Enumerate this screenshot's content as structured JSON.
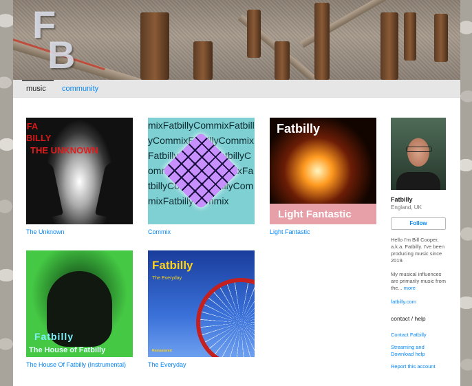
{
  "logo": {
    "letter1": "F",
    "letter2": "B"
  },
  "tabs": [
    {
      "label": "music"
    },
    {
      "label": "community"
    }
  ],
  "albums": [
    {
      "title": "The Unknown",
      "cover_text": {
        "vertical": "FA BILLY",
        "main": "THE UNKNOWN"
      }
    },
    {
      "title": "Commix",
      "cover_text": {
        "pattern": "mixFatbillyCommixFatbillyCommixFatbillyCommixFatbillyCommixFatbillyCommixFatbillyCommixFatbillyCommixFatbillyCommixFatbillyCommix"
      }
    },
    {
      "title": "Light Fantastic",
      "cover_text": {
        "top": "Fatbilly",
        "bottom": "Light Fantastic"
      }
    },
    {
      "title": "The House Of Fatbilly (Instrumental)",
      "cover_text": {
        "top": "Fatbilly",
        "bottom": "The House of Fatbilly"
      }
    },
    {
      "title": "The Everyday",
      "cover_text": {
        "top": "Fatbilly",
        "subtitle": "The Everyday",
        "tag": "Remastered"
      }
    }
  ],
  "artist": {
    "name": "Fatbilly",
    "location": "England, UK",
    "follow_label": "Follow",
    "bio_1": "Hello I'm Bill Cooper, a.k.a. Fatbilly. I've been producing music since 2019.",
    "bio_2": "My musical influences are primarily music from the...",
    "more_label": "more",
    "website": "fatbilly.com"
  },
  "contact": {
    "heading": "contact / help",
    "links": [
      {
        "label": "Contact Fatbilly"
      },
      {
        "label": "Streaming and Download help"
      },
      {
        "label": "Report this account"
      }
    ]
  },
  "colors": {
    "link": "#0687f5",
    "tabbar": "#e6e6e6"
  }
}
